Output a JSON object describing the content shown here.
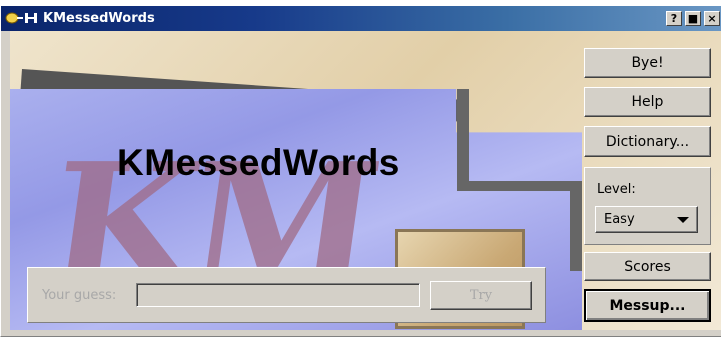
{
  "window": {
    "title": "KMessedWords",
    "controls": {
      "help": "?",
      "maximize": "■",
      "close": "×"
    }
  },
  "main": {
    "app_title": "KMessedWords"
  },
  "buttons": {
    "bye": "Bye!",
    "help": "Help",
    "dictionary": "Dictionary...",
    "scores": "Scores",
    "messup": "Messup..."
  },
  "level": {
    "label": "Level:",
    "selected": "Easy"
  },
  "guess": {
    "label": "Your guess:",
    "value": "",
    "try_label": "Try"
  },
  "background_art": {
    "letters": "KM"
  },
  "colors": {
    "titlebar_start": "#0a246a",
    "titlebar_end": "#6a97c4",
    "panel": "#d4d0c8",
    "art_blue": "#9a9fe8",
    "art_letters": "#a06b86"
  },
  "icons": {
    "app_icon": "kde-window-icon",
    "level_dropdown": "triangle-down-icon"
  }
}
